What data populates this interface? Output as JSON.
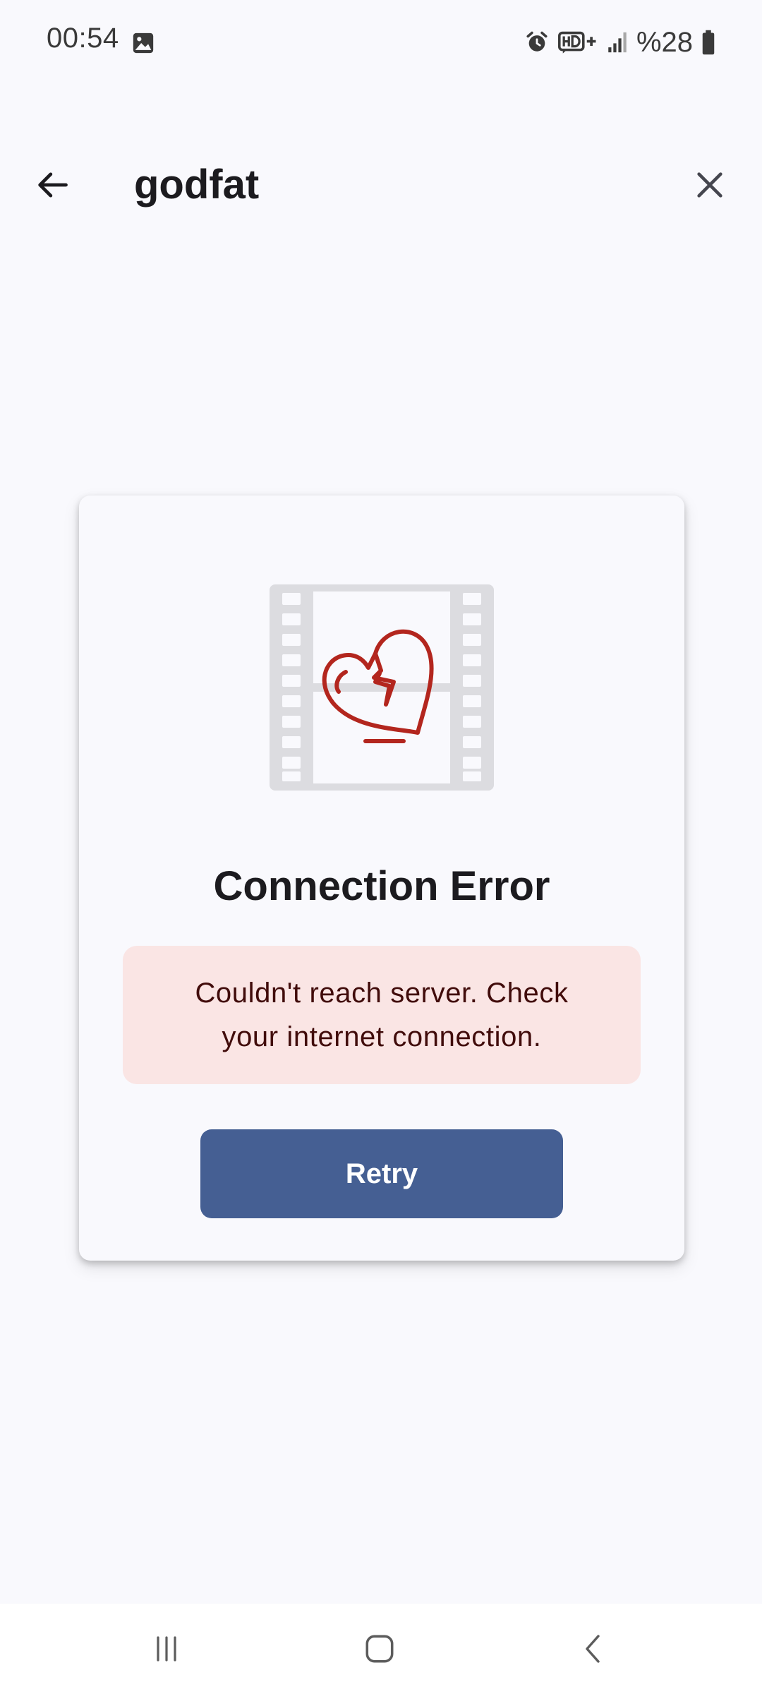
{
  "status_bar": {
    "time": "00:54",
    "battery_text": "%28",
    "icons": [
      "image-icon",
      "alarm-icon",
      "hd-plus-icon",
      "signal-icon",
      "battery-icon"
    ]
  },
  "top_bar": {
    "title": "godfat",
    "back_icon": "arrow-back-icon",
    "close_icon": "close-icon"
  },
  "error_card": {
    "title": "Connection Error",
    "message": "Couldn't reach server. Check your internet connection.",
    "retry_label": "Retry",
    "illustration": "broken-heart-film-icon"
  },
  "colors": {
    "background": "#f9f9fd",
    "accent": "#455f93",
    "error_container": "#fae5e4",
    "on_error_container": "#410c0b",
    "heart": "#b3261e",
    "film": "#dcdce0"
  },
  "nav_bar": {
    "icons": [
      "recents-icon",
      "home-icon",
      "back-nav-icon"
    ]
  }
}
